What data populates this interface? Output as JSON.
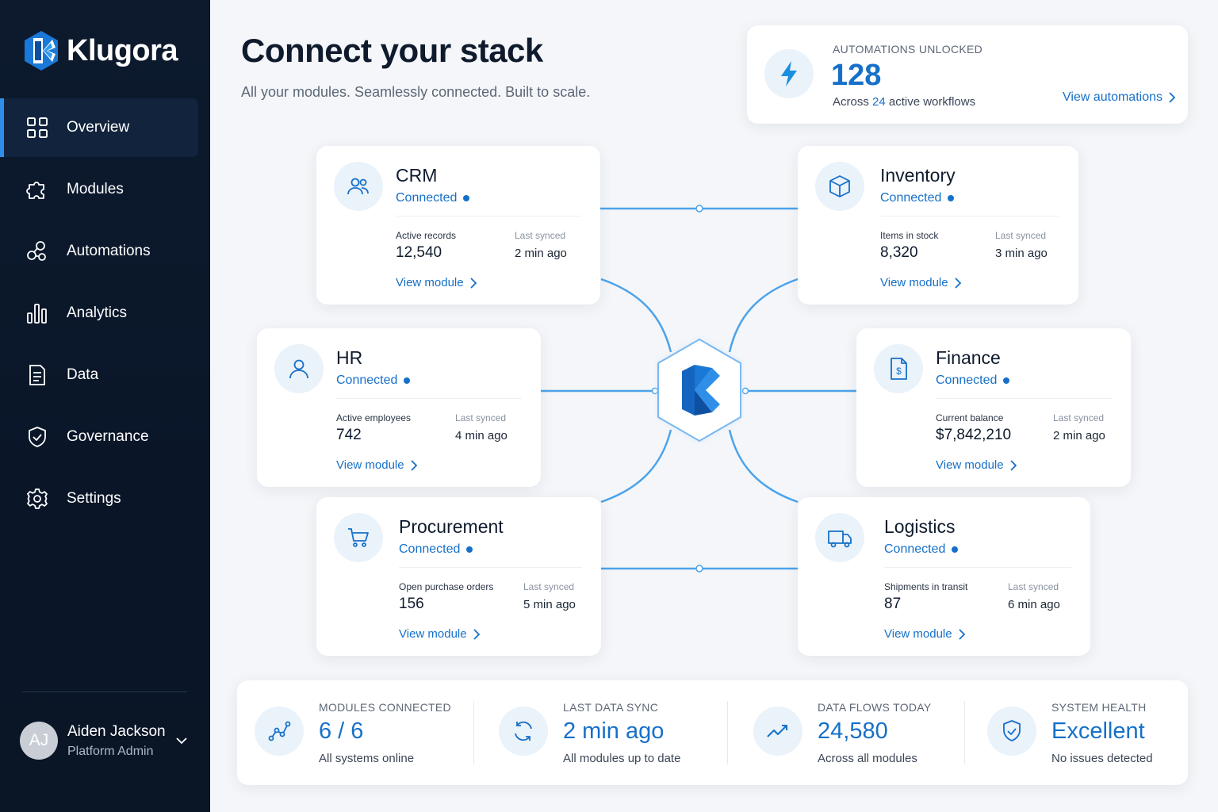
{
  "app": {
    "name": "Klugora"
  },
  "sidebar": {
    "items": [
      {
        "label": "Overview",
        "icon": "grid-icon",
        "active": true
      },
      {
        "label": "Modules",
        "icon": "puzzle-icon",
        "active": false
      },
      {
        "label": "Automations",
        "icon": "nodes-icon",
        "active": false
      },
      {
        "label": "Analytics",
        "icon": "bar-chart-icon",
        "active": false
      },
      {
        "label": "Data",
        "icon": "document-icon",
        "active": false
      },
      {
        "label": "Governance",
        "icon": "shield-icon",
        "active": false
      },
      {
        "label": "Settings",
        "icon": "gear-icon",
        "active": false
      }
    ]
  },
  "user": {
    "initials": "AJ",
    "name": "Aiden Jackson",
    "role": "Platform Admin"
  },
  "header": {
    "title": "Connect your stack",
    "subtitle": "All your modules. Seamlessly connected. Built to scale."
  },
  "automations": {
    "label": "AUTOMATIONS UNLOCKED",
    "value": "128",
    "sub_prefix": "Across",
    "sub_count": "24",
    "sub_suffix": "active workflows",
    "link": "View automations"
  },
  "modules": {
    "crm": {
      "name": "CRM",
      "status": "Connected",
      "metric_label": "Active records",
      "metric_value": "12,540",
      "sync_label": "Last synced",
      "sync_value": "2 min ago",
      "link": "View module"
    },
    "inventory": {
      "name": "Inventory",
      "status": "Connected",
      "metric_label": "Items in stock",
      "metric_value": "8,320",
      "sync_label": "Last synced",
      "sync_value": "3 min ago",
      "link": "View module"
    },
    "hr": {
      "name": "HR",
      "status": "Connected",
      "metric_label": "Active employees",
      "metric_value": "742",
      "sync_label": "Last synced",
      "sync_value": "4 min ago",
      "link": "View module"
    },
    "finance": {
      "name": "Finance",
      "status": "Connected",
      "metric_label": "Current balance",
      "metric_value": "$7,842,210",
      "sync_label": "Last synced",
      "sync_value": "2 min ago",
      "link": "View module"
    },
    "procurement": {
      "name": "Procurement",
      "status": "Connected",
      "metric_label": "Open purchase orders",
      "metric_value": "156",
      "sync_label": "Last synced",
      "sync_value": "5 min ago",
      "link": "View module"
    },
    "logistics": {
      "name": "Logistics",
      "status": "Connected",
      "metric_label": "Shipments in transit",
      "metric_value": "87",
      "sync_label": "Last synced",
      "sync_value": "6 min ago",
      "link": "View module"
    }
  },
  "stats": [
    {
      "label": "MODULES CONNECTED",
      "value": "6 / 6",
      "sub": "All systems online",
      "icon": "network-icon"
    },
    {
      "label": "LAST DATA SYNC",
      "value": "2 min ago",
      "sub": "All modules up to date",
      "icon": "sync-icon"
    },
    {
      "label": "DATA FLOWS TODAY",
      "value": "24,580",
      "sub": "Across all modules",
      "icon": "trend-icon"
    },
    {
      "label": "SYSTEM HEALTH",
      "value": "Excellent",
      "sub": "No issues detected",
      "icon": "shield-check-icon"
    }
  ],
  "colors": {
    "accent": "#1670c9",
    "sidebar": "#0d1a2e",
    "connector": "#4da3ea"
  }
}
